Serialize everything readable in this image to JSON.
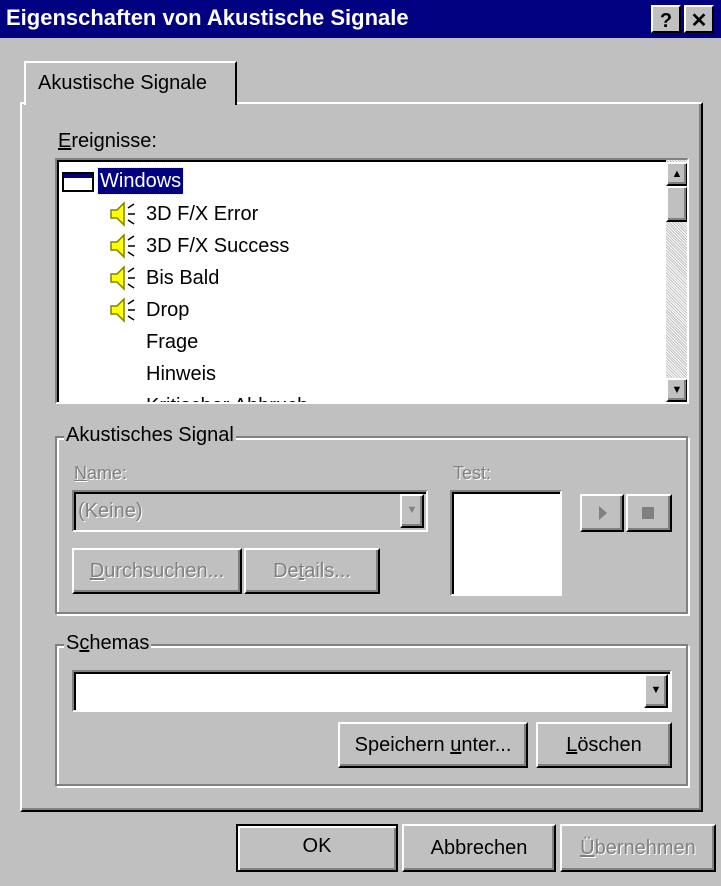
{
  "window": {
    "title": "Eigenschaften von Akustische Signale",
    "help_label": "?",
    "close_label": "✕"
  },
  "tab": {
    "label": "Akustische Signale"
  },
  "events": {
    "label_prefix": "E",
    "label_rest": "reignisse:",
    "root": "Windows",
    "items": [
      {
        "label": "3D F/X Error",
        "has_sound": true
      },
      {
        "label": "3D F/X Success",
        "has_sound": true
      },
      {
        "label": "Bis Bald",
        "has_sound": true
      },
      {
        "label": "Drop",
        "has_sound": true
      },
      {
        "label": "Frage",
        "has_sound": false
      },
      {
        "label": "Hinweis",
        "has_sound": false
      },
      {
        "label": "Kritischer Abbruch",
        "has_sound": false
      }
    ]
  },
  "sound": {
    "group_label": "Akustisches Signal",
    "name_prefix": "N",
    "name_rest": "ame:",
    "name_value": "(Keine)",
    "test_label": "Test:",
    "browse_prefix": "D",
    "browse_rest": "urchsuchen...",
    "details_pre": "De",
    "details_u": "t",
    "details_post": "ails..."
  },
  "schemes": {
    "group_pre": "S",
    "group_u": "c",
    "group_post": "hemas",
    "value": "",
    "save_pre": "Speichern ",
    "save_u": "u",
    "save_post": "nter...",
    "delete_u": "L",
    "delete_post": "öschen"
  },
  "footer": {
    "ok": "OK",
    "cancel": "Abbrechen",
    "apply_u": "Ü",
    "apply_post": "bernehmen"
  }
}
